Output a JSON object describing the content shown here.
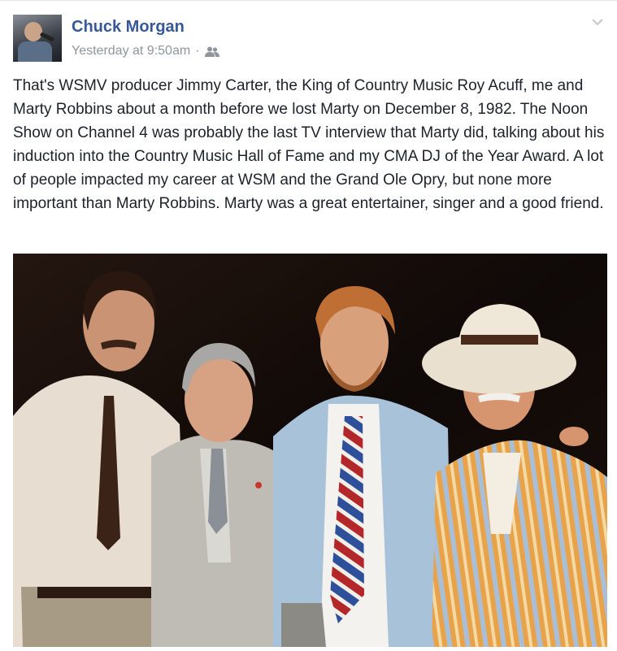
{
  "post": {
    "author": "Chuck Morgan",
    "timestamp": "Yesterday at 9:50am",
    "separator": "·",
    "audience_icon": "friends-icon",
    "menu_icon": "chevron-down-icon",
    "text": "That's WSMV producer Jimmy Carter, the King of Country Music Roy Acuff, me and Marty Robbins about a month before we lost Marty on December 8, 1982. The Noon Show on Channel 4 was probably the last TV interview that Marty did, talking about his induction into the Country Music Hall of Fame and my CMA DJ of the Year Award. A lot of people impacted my career at WSM and the Grand Ole Opry, but none more important than Marty Robbins. Marty was a great entertainer, singer and a good friend."
  },
  "colors": {
    "author_link": "#365899",
    "meta_text": "#90949c",
    "body_text": "#1d2129",
    "background": "#ffffff"
  }
}
